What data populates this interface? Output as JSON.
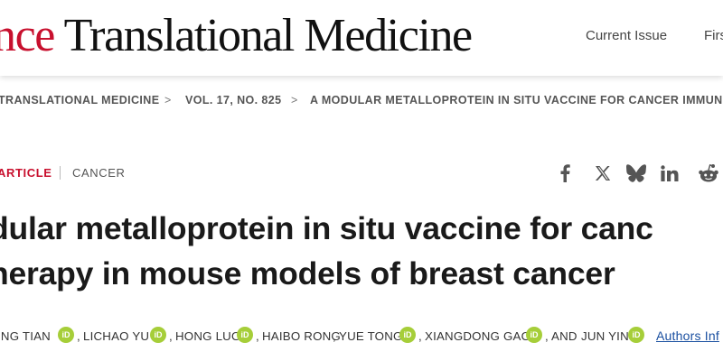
{
  "header": {
    "brand_accent": "nce",
    "brand_main": " Translational Medicine",
    "nav": [
      "Current Issue",
      "Firs"
    ]
  },
  "breadcrumb": {
    "items": [
      "TRANSLATIONAL MEDICINE",
      "VOL. 17, NO. 825",
      "A MODULAR METALLOPROTEIN IN SITU VACCINE FOR CANCER IMMUNOTI"
    ],
    "separator": ">"
  },
  "article": {
    "type": "ARTICLE",
    "subject": "CANCER",
    "title_lines": [
      "dular metalloprotein in situ vaccine for canc",
      "herapy in mouse models of breast cancer"
    ]
  },
  "share": {
    "icons": [
      "facebook-icon",
      "x-icon",
      "bluesky-icon",
      "linkedin-icon",
      "reddit-icon"
    ],
    "glyphs": [
      "f",
      "𝕏",
      "",
      "in",
      ""
    ]
  },
  "authors": {
    "names": [
      "ING TIAN",
      "LICHAO YU",
      "HONG LUO",
      "HAIBO RONG",
      "YUE TONG",
      "XIANGDONG GAO",
      "JUN YIN"
    ],
    "separators": [
      ",",
      ",",
      ",",
      ",",
      ",",
      ", AND"
    ],
    "orcid_label": "iD",
    "info_link": "Authors Inf"
  },
  "colors": {
    "brand_red": "#c8102e",
    "orcid_green": "#a6ce39",
    "link_blue": "#1a4fa0"
  }
}
